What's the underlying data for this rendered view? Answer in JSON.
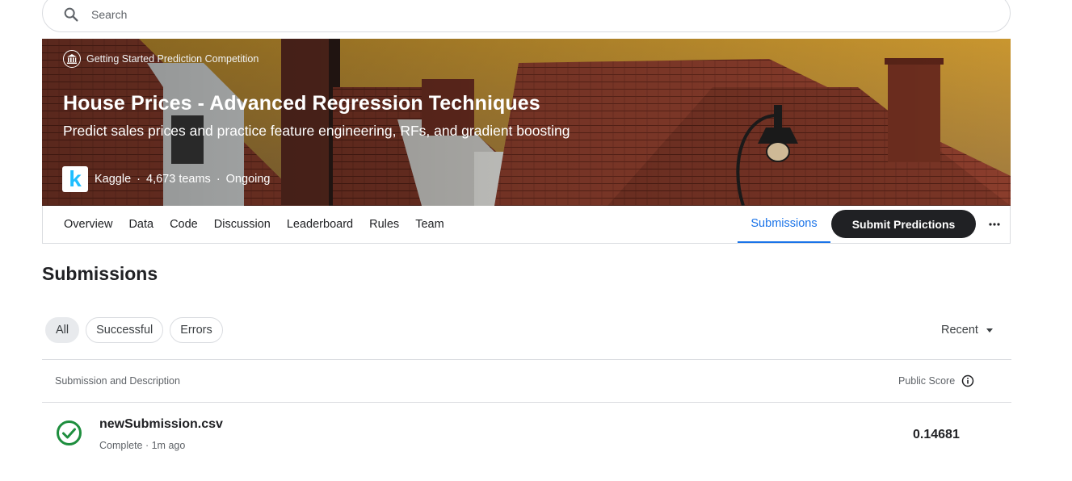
{
  "search": {
    "placeholder": "Search"
  },
  "banner": {
    "competition_type": "Getting Started Prediction Competition",
    "title": "House Prices - Advanced Regression Techniques",
    "subtitle": "Predict sales prices and practice feature engineering, RFs, and gradient boosting",
    "host_logo_letter": "k",
    "host": "Kaggle",
    "teams": "4,673 teams",
    "status": "Ongoing",
    "separator": "·"
  },
  "tabs": {
    "items": [
      "Overview",
      "Data",
      "Code",
      "Discussion",
      "Leaderboard",
      "Rules",
      "Team"
    ],
    "active": "Submissions",
    "submit_label": "Submit Predictions",
    "more_icon": "more-horizontal-icon"
  },
  "submissions": {
    "title": "Submissions",
    "filters": [
      "All",
      "Successful",
      "Errors"
    ],
    "sort_label": "Recent",
    "columns": {
      "left": "Submission and Description",
      "right": "Public Score"
    },
    "rows": [
      {
        "filename": "newSubmission.csv",
        "status": "Complete · 1m ago",
        "score": "0.14681",
        "icon": "check-circle-icon"
      }
    ]
  },
  "colors": {
    "accent": "#1a73e8",
    "success": "#1e8e3e",
    "dark_button": "#202124"
  }
}
